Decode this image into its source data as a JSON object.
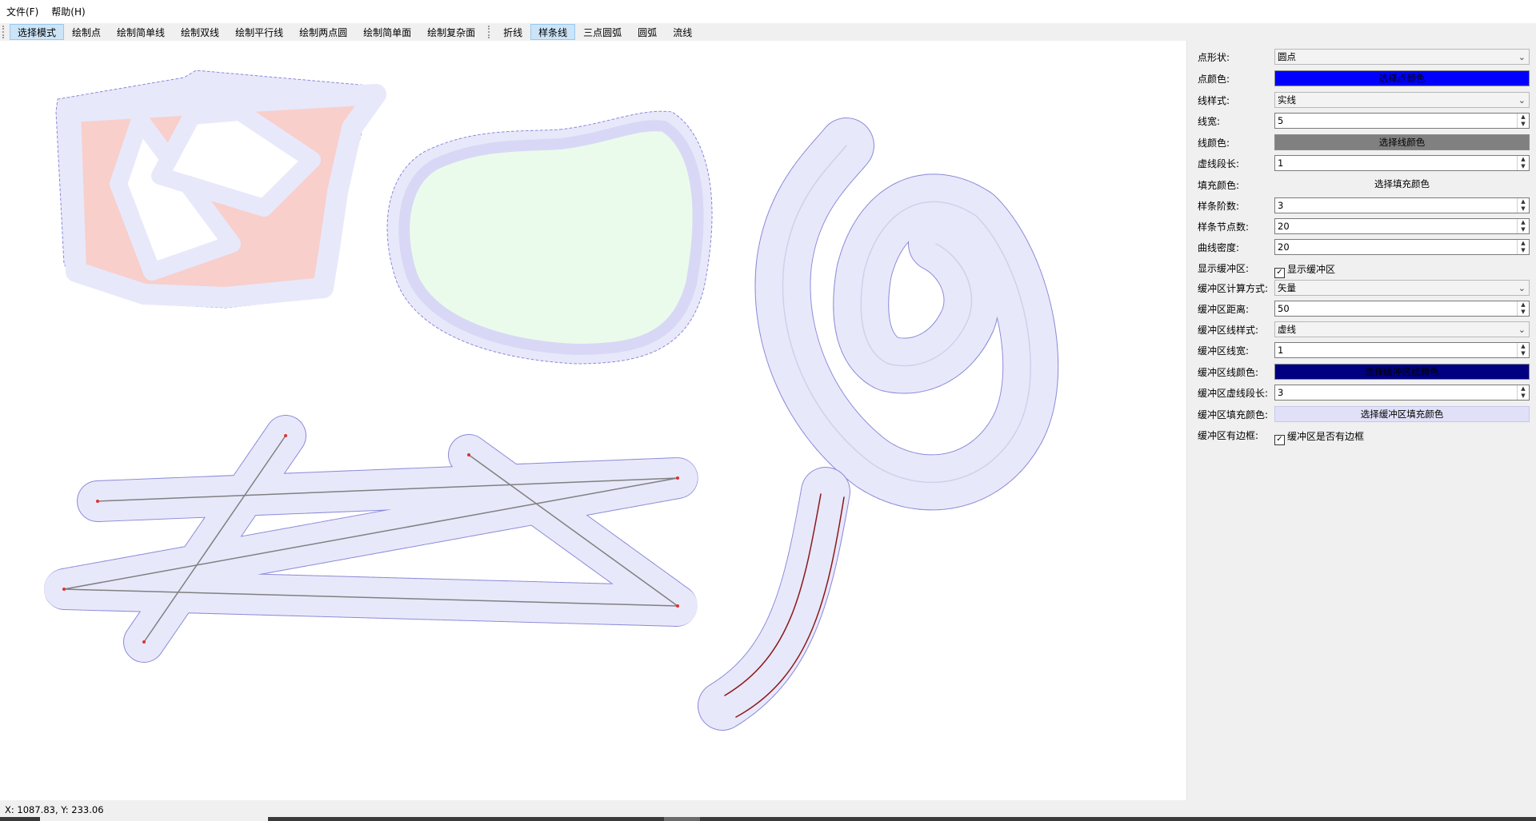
{
  "menu": {
    "file": "文件(F)",
    "help": "帮助(H)"
  },
  "toolbar": {
    "tools": [
      "选择模式",
      "绘制点",
      "绘制简单线",
      "绘制双线",
      "绘制平行线",
      "绘制两点圆",
      "绘制简单面",
      "绘制复杂面"
    ],
    "modes": [
      "折线",
      "样条线",
      "三点圆弧",
      "圆弧",
      "流线"
    ],
    "active_tool": "选择模式",
    "active_mode": "样条线"
  },
  "panel": {
    "point_shape": {
      "label": "点形状:",
      "value": "圆点"
    },
    "point_color": {
      "label": "点颜色:",
      "button": "选择点颜色",
      "color": "#0000ff"
    },
    "line_style": {
      "label": "线样式:",
      "value": "实线"
    },
    "line_width": {
      "label": "线宽:",
      "value": "5"
    },
    "line_color": {
      "label": "线颜色:",
      "button": "选择线颜色",
      "color": "#808080"
    },
    "dash_length": {
      "label": "虚线段长:",
      "value": "1"
    },
    "fill_color": {
      "label": "填充颜色:",
      "button": "选择填充颜色"
    },
    "spline_order": {
      "label": "样条阶数:",
      "value": "3"
    },
    "spline_nodes": {
      "label": "样条节点数:",
      "value": "20"
    },
    "curve_density": {
      "label": "曲线密度:",
      "value": "20"
    },
    "show_buffer": {
      "label": "显示缓冲区:",
      "checkbox": "显示缓冲区",
      "checked": true
    },
    "buffer_method": {
      "label": "缓冲区计算方式:",
      "value": "矢量"
    },
    "buffer_distance": {
      "label": "缓冲区距离:",
      "value": "50"
    },
    "buffer_line_style": {
      "label": "缓冲区线样式:",
      "value": "虚线"
    },
    "buffer_line_width": {
      "label": "缓冲区线宽:",
      "value": "1"
    },
    "buffer_line_color": {
      "label": "缓冲区线颜色:",
      "button": "选择缓冲区线颜色",
      "color": "#000080"
    },
    "buffer_dash_length": {
      "label": "缓冲区虚线段长:",
      "value": "3"
    },
    "buffer_fill_color": {
      "label": "缓冲区填充颜色:",
      "button": "选择缓冲区填充颜色",
      "color": "#e0e0f8"
    },
    "buffer_border": {
      "label": "缓冲区有边框:",
      "checkbox": "缓冲区是否有边框",
      "checked": true
    }
  },
  "status": {
    "coords": "X: 1087.83, Y: 233.06"
  },
  "colors": {
    "buffer_fill": "#e8e8fb",
    "buffer_stroke": "#8a8ad8",
    "polygon_fill": "#f8cfcb",
    "spline_fill": "#ebfbeb",
    "polyline": "#808080",
    "vertex": "#e03030",
    "parallel_line": "#8b1a1a"
  }
}
